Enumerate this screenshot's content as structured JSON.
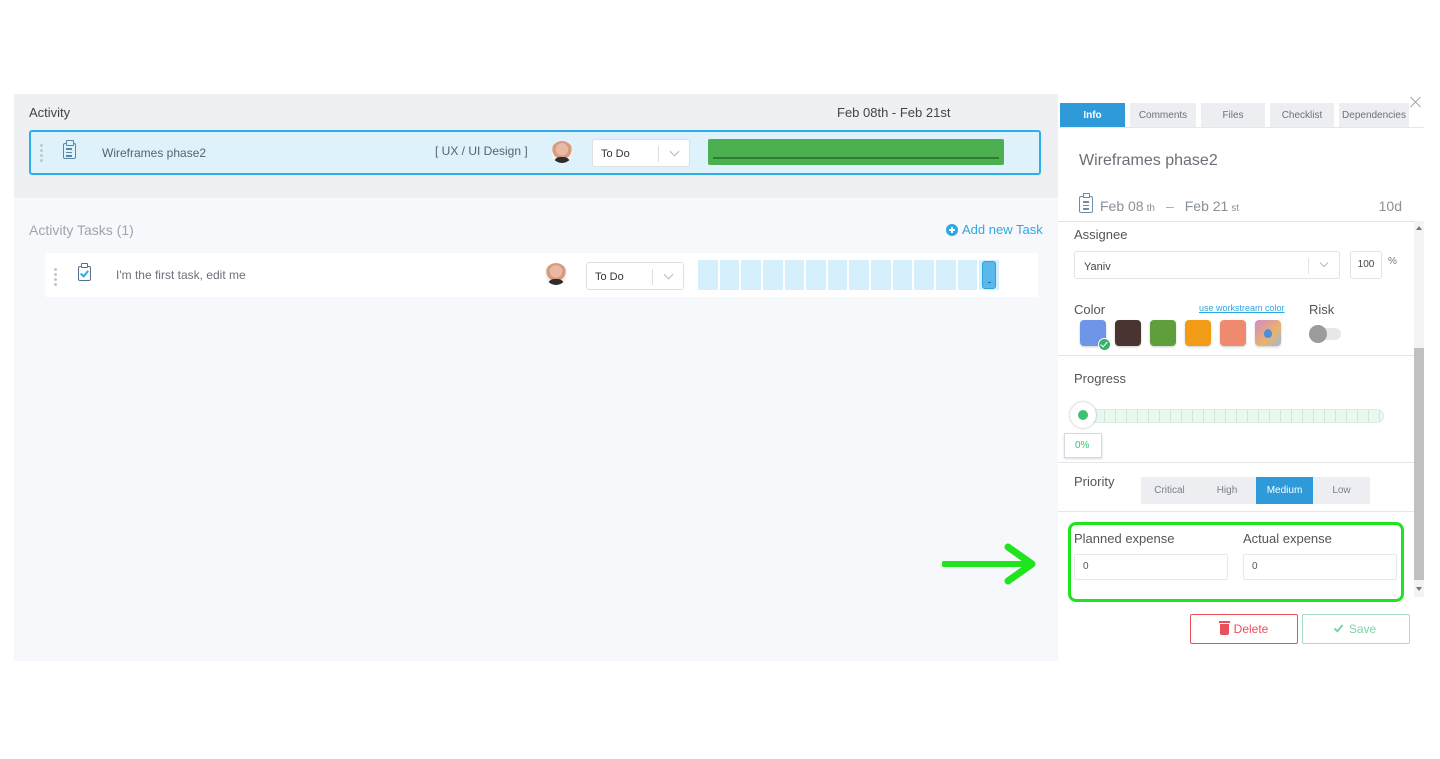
{
  "activity": {
    "section_title": "Activity",
    "date_range": "Feb 08th -  Feb 21st",
    "row": {
      "name": "Wireframes phase2",
      "workstream": "[ UX / UI Design ]",
      "status": "To Do",
      "bar_color": "#4caf50"
    }
  },
  "tasks": {
    "section_title": "Activity Tasks (1)",
    "add_label": "Add new Task",
    "items": [
      {
        "name": "I'm the first task, edit me",
        "status": "To Do",
        "timeline_segments": 14
      }
    ]
  },
  "panel": {
    "tabs": [
      {
        "label": "Info",
        "active": true
      },
      {
        "label": "Comments",
        "active": false
      },
      {
        "label": "Files",
        "active": false
      },
      {
        "label": "Checklist",
        "active": false
      },
      {
        "label": "Dependencies",
        "active": false
      }
    ],
    "title": "Wireframes phase2",
    "start_date": "Feb 08",
    "start_suffix": "th",
    "date_separator": "–",
    "end_date": "Feb 21",
    "end_suffix": "st",
    "duration": "10d",
    "assignee_label": "Assignee",
    "assignee_value": "Yaniv",
    "allocation": "100",
    "allocation_unit": "%",
    "color_label": "Color",
    "workstream_color_link": "use workstream color",
    "colors": [
      "#6f95e8",
      "#4a3432",
      "#5e9e3b",
      "#f29b17",
      "#ee8a6e",
      "custom"
    ],
    "selected_color_index": 0,
    "risk_label": "Risk",
    "risk_enabled": false,
    "progress_label": "Progress",
    "progress_value": 0,
    "progress_text": "0%",
    "priority_label": "Priority",
    "priorities": [
      {
        "label": "Critical",
        "active": false
      },
      {
        "label": "High",
        "active": false
      },
      {
        "label": "Medium",
        "active": true
      },
      {
        "label": "Low",
        "active": false
      }
    ],
    "planned_expense_label": "Planned expense",
    "planned_expense_value": "0",
    "actual_expense_label": "Actual expense",
    "actual_expense_value": "0",
    "delete_label": "Delete",
    "save_label": "Save"
  },
  "annotation": {
    "arrow_color": "#1ee51e",
    "highlight_color": "#1ee51e"
  }
}
